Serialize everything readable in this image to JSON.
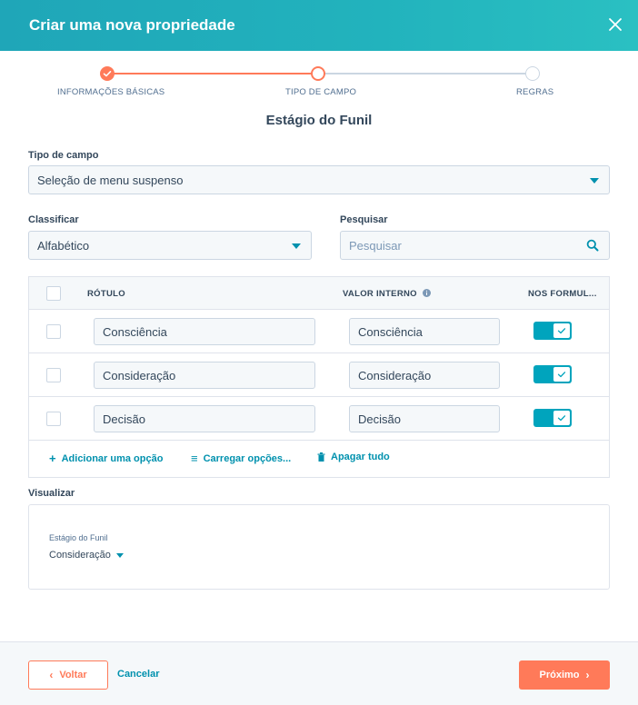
{
  "header": {
    "title": "Criar uma nova propriedade",
    "close_icon": "close-icon"
  },
  "stepper": {
    "steps": [
      {
        "label": "INFORMAÇÕES BÁSICAS",
        "state": "complete"
      },
      {
        "label": "TIPO DE CAMPO",
        "state": "current"
      },
      {
        "label": "REGRAS",
        "state": "upcoming"
      }
    ]
  },
  "section_title": "Estágio do Funil",
  "field_type": {
    "label": "Tipo de campo",
    "value": "Seleção de menu suspenso"
  },
  "sort": {
    "label": "Classificar",
    "value": "Alfabético"
  },
  "search": {
    "label": "Pesquisar",
    "placeholder": "Pesquisar"
  },
  "table": {
    "headers": {
      "label": "RÓTULO",
      "internal_value": "VALOR INTERNO",
      "in_forms": "NOS FORMUL..."
    },
    "rows": [
      {
        "label": "Consciência",
        "internal_value": "Consciência",
        "in_forms": true
      },
      {
        "label": "Consideração",
        "internal_value": "Consideração",
        "in_forms": true
      },
      {
        "label": "Decisão",
        "internal_value": "Decisão",
        "in_forms": true
      }
    ],
    "actions": {
      "add": "Adicionar uma opção",
      "load": "Carregar opções...",
      "clear": "Apagar tudo"
    }
  },
  "preview": {
    "label": "Visualizar",
    "field_label": "Estágio do Funil",
    "field_value": "Consideração"
  },
  "footer": {
    "back": "Voltar",
    "cancel": "Cancelar",
    "next": "Próximo"
  },
  "colors": {
    "accent": "#00a4bd",
    "cta": "#ff7a59",
    "link": "#0091ae",
    "text": "#33475b"
  }
}
